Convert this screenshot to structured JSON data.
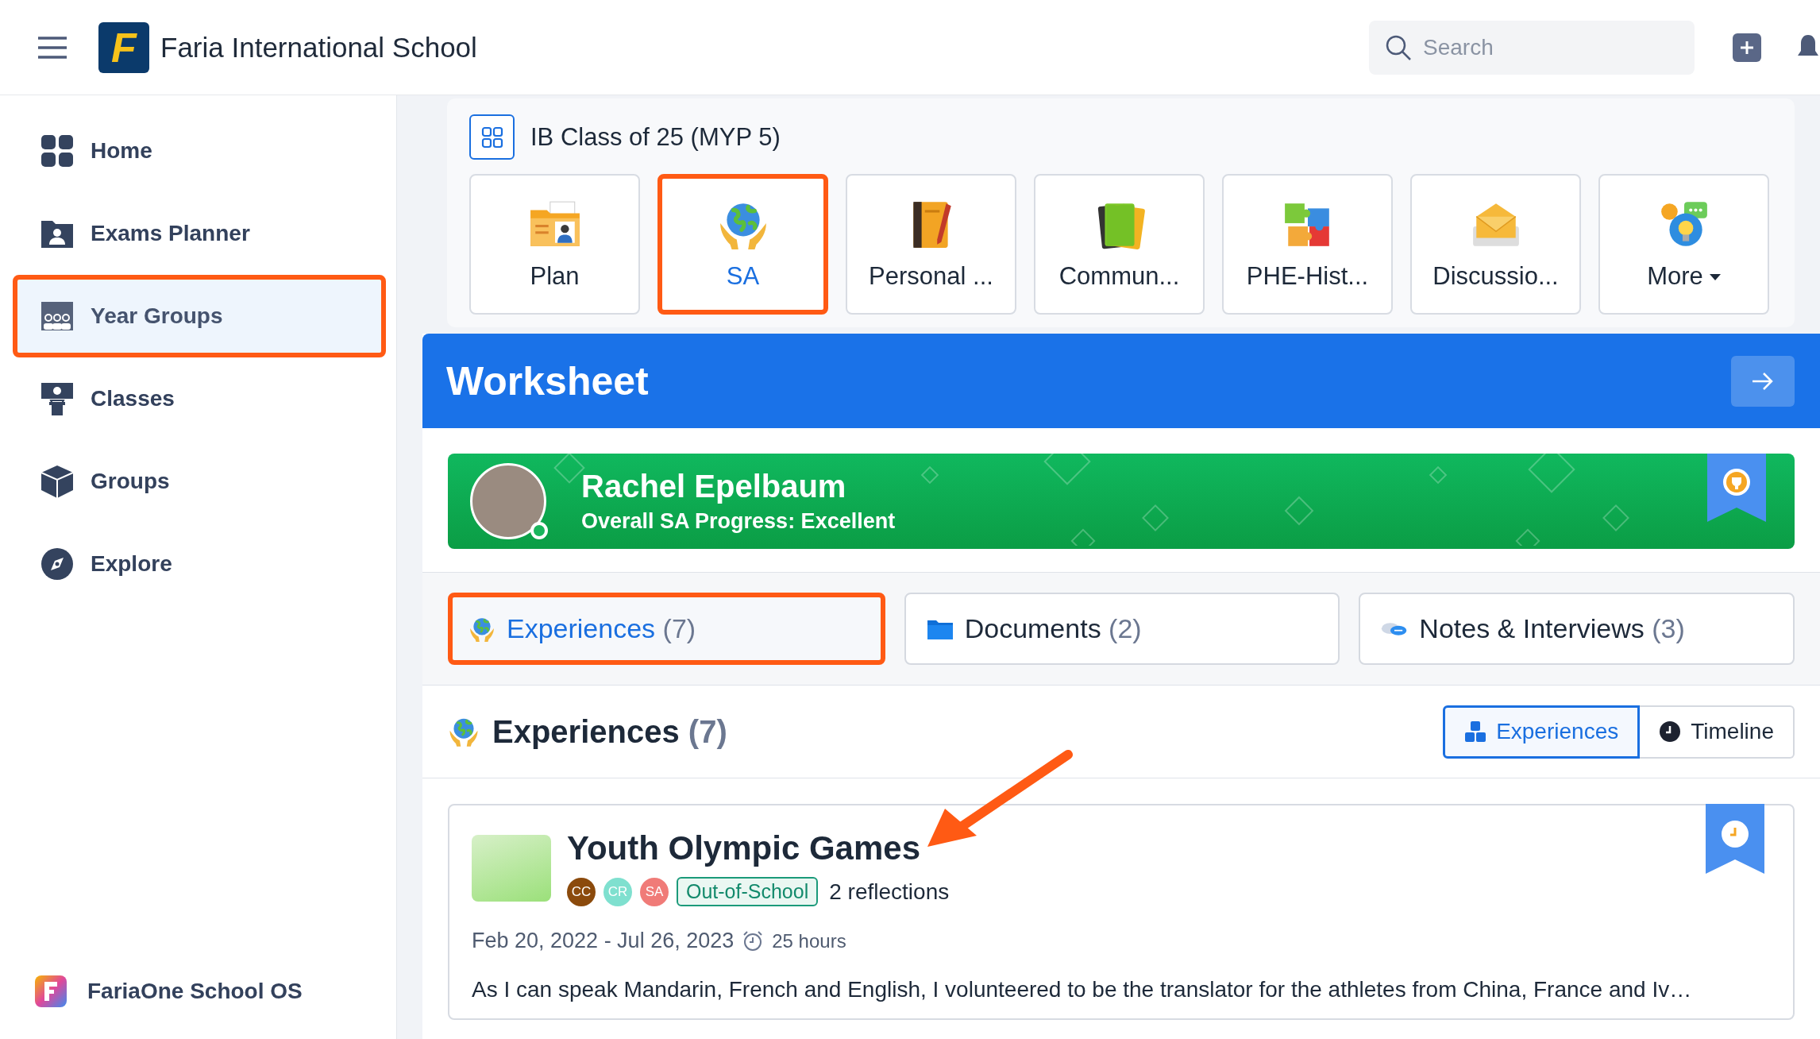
{
  "header": {
    "logo_letter": "F",
    "school_name": "Faria International School",
    "search": {
      "placeholder": "Search"
    }
  },
  "sidebar": {
    "items": [
      {
        "label": "Home",
        "selected": false,
        "highlighted": false
      },
      {
        "label": "Exams Planner",
        "selected": false,
        "highlighted": false
      },
      {
        "label": "Year Groups",
        "selected": true,
        "highlighted": true
      },
      {
        "label": "Classes",
        "selected": false,
        "highlighted": false
      },
      {
        "label": "Groups",
        "selected": false,
        "highlighted": false
      },
      {
        "label": "Explore",
        "selected": false,
        "highlighted": false
      }
    ],
    "footer": {
      "label": "FariaOne School OS"
    }
  },
  "class_title": "IB Class of 25 (MYP 5)",
  "apps": [
    {
      "label": "Plan",
      "kind": "app",
      "selected": false,
      "highlighted": false
    },
    {
      "label": "SA",
      "kind": "app",
      "selected": true,
      "highlighted": true
    },
    {
      "label": "Personal ...",
      "kind": "app",
      "selected": false,
      "highlighted": false
    },
    {
      "label": "Commun...",
      "kind": "app",
      "selected": false,
      "highlighted": false
    },
    {
      "label": "PHE-Hist...",
      "kind": "app",
      "selected": false,
      "highlighted": false
    },
    {
      "label": "Discussio...",
      "kind": "app",
      "selected": false,
      "highlighted": false
    },
    {
      "label": "More",
      "kind": "menu",
      "selected": false,
      "highlighted": false
    }
  ],
  "worksheet": {
    "title": "Worksheet"
  },
  "student": {
    "name": "Rachel Epelbaum",
    "progress": "Overall SA Progress: Excellent",
    "online": true
  },
  "tabs": [
    {
      "label": "Experiences",
      "count": "(7)",
      "selected": true,
      "highlighted": true
    },
    {
      "label": "Documents",
      "count": "(2)",
      "selected": false,
      "highlighted": false
    },
    {
      "label": "Notes & Interviews",
      "count": "(3)",
      "selected": false,
      "highlighted": false
    }
  ],
  "section": {
    "title": "Experiences",
    "count": "(7)",
    "views": [
      {
        "label": "Experiences",
        "selected": true
      },
      {
        "label": "Timeline",
        "selected": false
      }
    ]
  },
  "experiences": [
    {
      "title": "Youth Olympic Games",
      "tags": [
        {
          "label": "CC",
          "color": "#8b4a0c"
        },
        {
          "label": "CR",
          "color": "#7fe0cf"
        },
        {
          "label": "SA",
          "color": "#f07b78"
        }
      ],
      "category": "Out-of-School",
      "reflections": "2 reflections",
      "dates": "Feb 20, 2022 - Jul 26, 2023",
      "duration": "25 hours",
      "description": "As I can speak Mandarin, French and English, I volunteered to be the translator for the athletes from China, France and Iv…"
    }
  ]
}
